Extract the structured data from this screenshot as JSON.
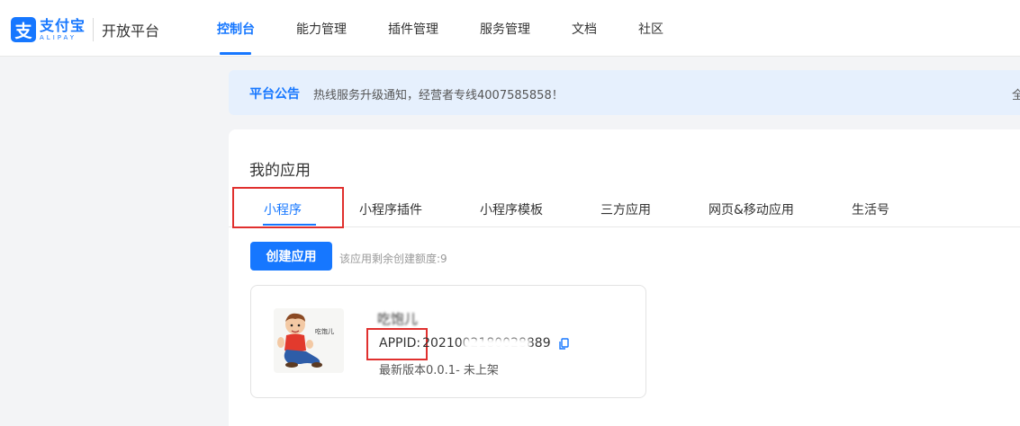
{
  "brand": {
    "logo_char": "支",
    "name_cn": "支付宝",
    "name_en": "ALIPAY",
    "platform": "开放平台"
  },
  "nav": {
    "items": [
      "控制台",
      "能力管理",
      "插件管理",
      "服务管理",
      "文档",
      "社区"
    ],
    "active_index": 0
  },
  "notice": {
    "title": "平台公告",
    "text": "热线服务升级通知，经营者专线4007585858！",
    "more": "全"
  },
  "apps": {
    "title": "我的应用",
    "tabs": [
      "小程序",
      "小程序插件",
      "小程序模板",
      "三方应用",
      "网页&移动应用",
      "生活号"
    ],
    "active_tab_index": 0,
    "create_button": "创建应用",
    "quota_text": "该应用剩余创建额度:9",
    "card": {
      "name": "吃饱儿",
      "appid_label": "APPID:",
      "appid_value": "2021002180028889",
      "version": "最新版本0.0.1-  未上架"
    }
  },
  "colors": {
    "accent": "#1677ff",
    "highlight_box": "#e0302e",
    "notice_bg": "#e6f0fd"
  },
  "icons": {
    "copy": "copy-icon",
    "logo": "alipay-logo-icon"
  }
}
